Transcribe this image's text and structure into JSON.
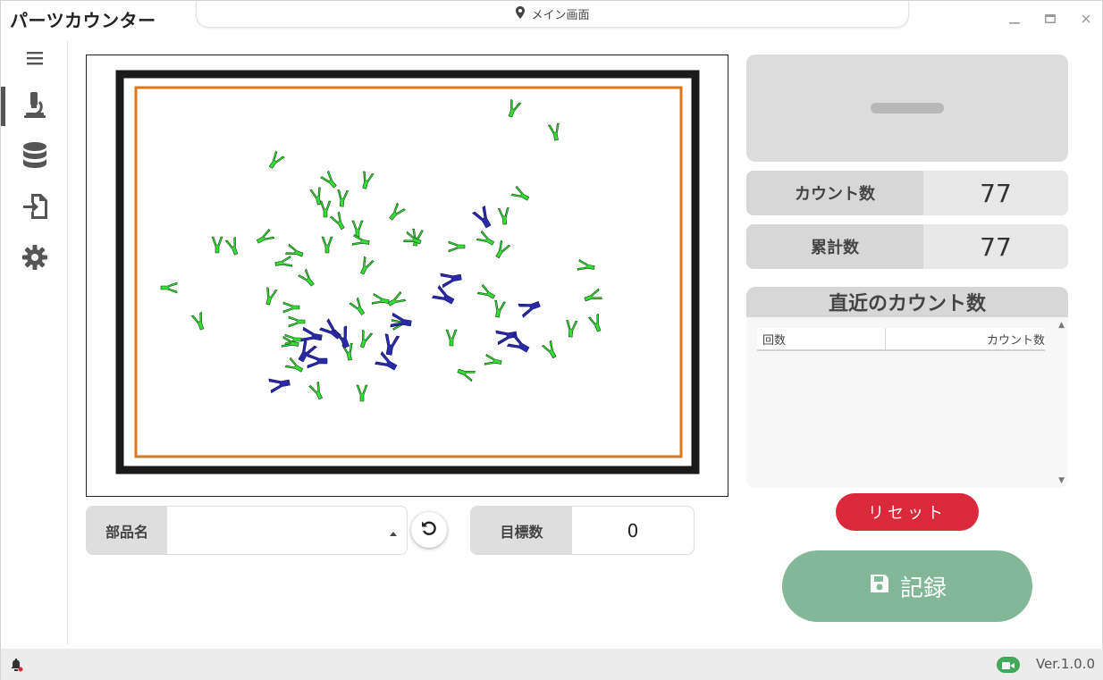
{
  "app": {
    "title": "パーツカウンター"
  },
  "location": {
    "label": "メイン画面",
    "icon": "map-pin-icon"
  },
  "sidebar": {
    "items": [
      {
        "name": "menu",
        "icon": "hamburger-icon"
      },
      {
        "name": "microscope",
        "icon": "microscope-icon",
        "active": true
      },
      {
        "name": "database",
        "icon": "database-icon"
      },
      {
        "name": "import",
        "icon": "import-icon"
      },
      {
        "name": "settings",
        "icon": "gear-icon"
      }
    ]
  },
  "form": {
    "part_name_label": "部品名",
    "part_name_value": "",
    "target_label": "目標数",
    "target_value": "0"
  },
  "stats": {
    "count_label": "カウント数",
    "count_value": "77",
    "total_label": "累計数",
    "total_value": "77"
  },
  "recent": {
    "title": "直近のカウント数",
    "columns": [
      "回数",
      "カウント数"
    ],
    "rows": []
  },
  "buttons": {
    "reset_label": "リセット",
    "record_label": "記録"
  },
  "statusbar": {
    "version": "Ver.1.0.0"
  },
  "colors": {
    "accent_red": "#d9293a",
    "record_green": "#82b797",
    "part_ok": "#33dd33",
    "part_ng": "#2a2aa8",
    "tray_border": "#e0761a",
    "camera_ok": "#42a95a"
  }
}
